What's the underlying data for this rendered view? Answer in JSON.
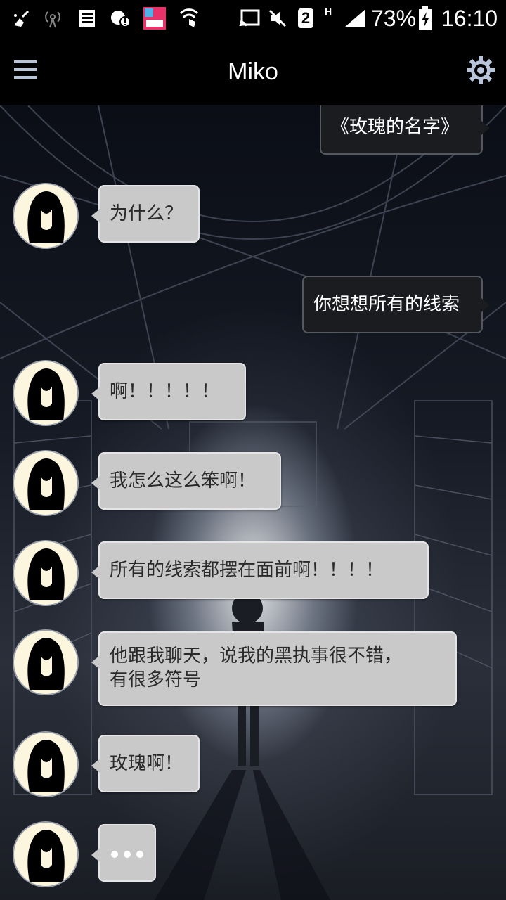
{
  "status_bar": {
    "battery_percent": "73%",
    "time": "16:10",
    "sim_badge": "2",
    "network_type": "H",
    "icons": [
      "cleaner-icon",
      "hotspot-icon",
      "storage-icon",
      "notification-alert-icon",
      "app-thumbnail-icon",
      "vpn-shield-icon",
      "cast-icon",
      "mute-icon",
      "sim-icon",
      "signal-icon",
      "battery-charging-icon"
    ]
  },
  "toolbar": {
    "title": "Miko",
    "menu_icon": "hamburger-menu-icon",
    "settings_icon": "gear-icon"
  },
  "messages": [
    {
      "side": "right",
      "text": "《玫瑰的名字》"
    },
    {
      "side": "left",
      "text": "为什么？"
    },
    {
      "side": "right",
      "text": "你想想所有的线索"
    },
    {
      "side": "left",
      "text": "啊！！！！！"
    },
    {
      "side": "left",
      "text": "我怎么这么笨啊！"
    },
    {
      "side": "left",
      "text": "所有的线索都摆在面前啊！！！！"
    },
    {
      "side": "left",
      "text_line1": "他跟我聊天，说我的黑执事很不错，",
      "text_line2": "有很多符号"
    },
    {
      "side": "left",
      "text": "玫瑰啊！"
    },
    {
      "side": "left",
      "typing": true
    }
  ],
  "colors": {
    "incoming_bubble": "#c9c9c9",
    "outgoing_bubble": "#1a1c20",
    "avatar_bg": "#fdf6de",
    "accent": "#b8c4d8"
  }
}
